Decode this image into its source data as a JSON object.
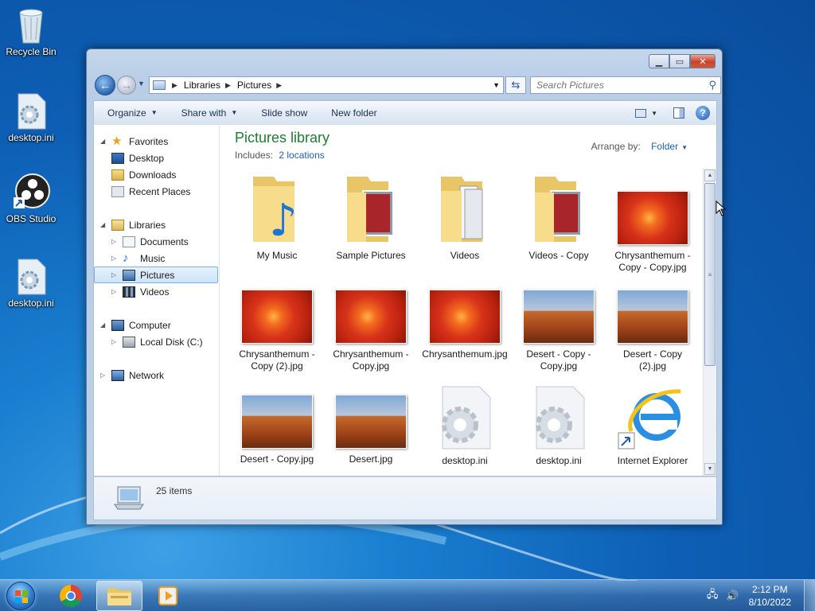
{
  "desktop": {
    "icons": [
      {
        "label": "Recycle Bin",
        "icon": "recycle-bin-icon"
      },
      {
        "label": "desktop.ini",
        "icon": "settings-file-icon"
      },
      {
        "label": "OBS Studio",
        "icon": "obs-studio-icon"
      },
      {
        "label": "desktop.ini",
        "icon": "settings-file-icon"
      }
    ]
  },
  "window": {
    "title": "",
    "breadcrumb": [
      "Libraries",
      "Pictures"
    ],
    "search_placeholder": "Search Pictures",
    "toolbar": {
      "organize": "Organize",
      "share_with": "Share with",
      "slide_show": "Slide show",
      "new_folder": "New folder"
    }
  },
  "nav_pane": {
    "favorites": {
      "label": "Favorites",
      "items": [
        "Desktop",
        "Downloads",
        "Recent Places"
      ]
    },
    "libraries": {
      "label": "Libraries",
      "items": [
        "Documents",
        "Music",
        "Pictures",
        "Videos"
      ],
      "selected": "Pictures"
    },
    "computer": {
      "label": "Computer",
      "items": [
        "Local Disk (C:)"
      ]
    },
    "network": {
      "label": "Network"
    }
  },
  "library": {
    "title": "Pictures library",
    "includes_label": "Includes:",
    "includes_link": "2 locations",
    "arrange_by_label": "Arrange by:",
    "arrange_by_value": "Folder"
  },
  "files": [
    {
      "name": "My Music",
      "kind": "folder-music"
    },
    {
      "name": "Sample Pictures",
      "kind": "folder-pictures"
    },
    {
      "name": "Videos",
      "kind": "folder-docs"
    },
    {
      "name": "Videos - Copy",
      "kind": "folder-pictures"
    },
    {
      "name": "Chrysanthemum - Copy - Copy.jpg",
      "kind": "flower"
    },
    {
      "name": "Chrysanthemum - Copy (2).jpg",
      "kind": "flower"
    },
    {
      "name": "Chrysanthemum - Copy.jpg",
      "kind": "flower"
    },
    {
      "name": "Chrysanthemum.jpg",
      "kind": "flower"
    },
    {
      "name": "Desert - Copy - Copy.jpg",
      "kind": "desert"
    },
    {
      "name": "Desert - Copy (2).jpg",
      "kind": "desert"
    },
    {
      "name": "Desert - Copy.jpg",
      "kind": "desert"
    },
    {
      "name": "Desert.jpg",
      "kind": "desert"
    },
    {
      "name": "desktop.ini",
      "kind": "ini"
    },
    {
      "name": "desktop.ini",
      "kind": "ini"
    },
    {
      "name": "Internet Explorer",
      "kind": "ie-shortcut"
    }
  ],
  "status": {
    "item_count": "25 items"
  },
  "taskbar": {
    "apps": [
      "windows-explorer-icon",
      "google-chrome-icon",
      "media-player-icon"
    ],
    "time": "2:12 PM",
    "date": "8/10/2022"
  },
  "colors": {
    "library_title": "#1f7a35",
    "link": "#1f5fb3",
    "desktop_bg": "#0d5fb5"
  }
}
